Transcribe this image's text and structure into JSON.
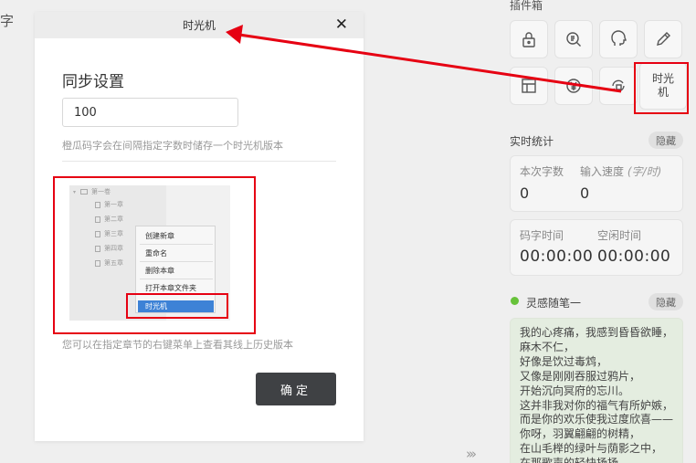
{
  "background": {
    "edge_char": "字",
    "expand_icon": "double-chevron-right"
  },
  "modal": {
    "title": "时光机",
    "close_symbol": "✕",
    "heading": "同步设置",
    "interval_value": "100",
    "description": "橙瓜码字会在间隔指定字数时储存一个时光机版本",
    "note": "您可以在指定章节的右键菜单上查看其线上历史版本",
    "confirm_label": "确定"
  },
  "demo_screenshot": {
    "volume": "第一卷",
    "chapters": [
      "第一章",
      "第二章",
      "第三章",
      "第四章",
      "第五章"
    ],
    "context_menu": [
      "创建新章",
      "重命名",
      "删除本章",
      "打开本章文件夹",
      "时光机"
    ]
  },
  "sidebar": {
    "plugins_title": "插件箱",
    "plugins": [
      {
        "icon": "lock-icon"
      },
      {
        "icon": "dictionary-search-icon"
      },
      {
        "icon": "head-profile-icon"
      },
      {
        "icon": "pencil-icon"
      },
      {
        "icon": "layout-icon"
      },
      {
        "icon": "yen-circle-icon"
      },
      {
        "icon": "sync-lock-icon"
      },
      {
        "icon": "time-machine",
        "label_line1": "时光",
        "label_line2": "机"
      }
    ],
    "stats": {
      "title": "实时统计",
      "hide_label": "隐藏",
      "words_label": "本次字数",
      "words_value": "0",
      "speed_label": "输入速度",
      "speed_unit": "(字/时)",
      "speed_value": "0",
      "typing_time_label": "码字时间",
      "typing_time_value": "00:00:00",
      "idle_time_label": "空闲时间",
      "idle_time_value": "00:00:00"
    },
    "notes": {
      "title": "灵感随笔一",
      "hide_label": "隐藏",
      "status_color": "#67c23a",
      "lines": [
        "我的心疼痛，我感到昏昏欲睡，",
        "麻木不仁，",
        "好像是饮过毒鸩，",
        "又像是刚刚吞服过鸦片，",
        "开始沉向冥府的忘川。",
        "这并非我对你的福气有所妒嫉，",
        "而是你的欢乐使我过度欣喜——",
        "你呀，羽翼翩翩的树精，",
        "在山毛榉的绿叶与荫影之中，",
        "在那歌声的轻快扬扬"
      ]
    }
  },
  "annotation_color": "#e60012"
}
